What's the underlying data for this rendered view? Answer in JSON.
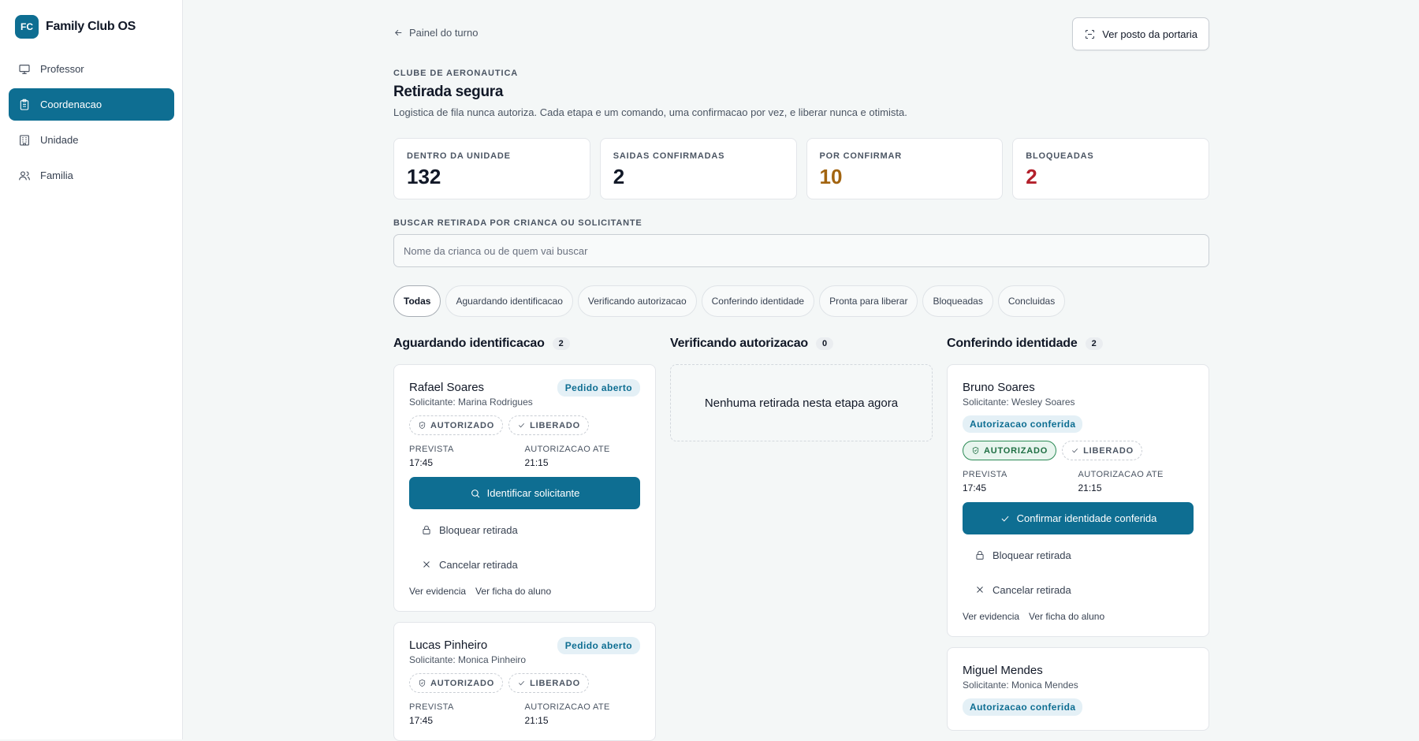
{
  "brand": {
    "logo": "FC",
    "name": "Family Club OS"
  },
  "nav": [
    {
      "label": "Professor",
      "icon": "presentation-icon",
      "active": false
    },
    {
      "label": "Coordenacao",
      "icon": "clipboard-icon",
      "active": true
    },
    {
      "label": "Unidade",
      "icon": "building-icon",
      "active": false
    },
    {
      "label": "Familia",
      "icon": "users-icon",
      "active": false
    }
  ],
  "header": {
    "back_label": "Painel do turno",
    "portaria_label": "Ver posto da portaria",
    "eyebrow": "CLUBE DE AERONAUTICA",
    "title": "Retirada segura",
    "subtitle": "Logistica de fila nunca autoriza. Cada etapa e um comando, uma confirmacao por vez, e liberar nunca e otimista."
  },
  "stats": [
    {
      "label": "DENTRO DA UNIDADE",
      "value": "132",
      "color": "#111827"
    },
    {
      "label": "SAIDAS CONFIRMADAS",
      "value": "2",
      "color": "#111827"
    },
    {
      "label": "POR CONFIRMAR",
      "value": "10",
      "color": "#a26410"
    },
    {
      "label": "BLOQUEADAS",
      "value": "2",
      "color": "#b3202b"
    }
  ],
  "search": {
    "label": "BUSCAR RETIRADA POR CRIANCA OU SOLICITANTE",
    "placeholder": "Nome da crianca ou de quem vai buscar",
    "value": ""
  },
  "filters": [
    "Todas",
    "Aguardando identificacao",
    "Verificando autorizacao",
    "Conferindo identidade",
    "Pronta para liberar",
    "Bloqueadas",
    "Concluidas"
  ],
  "columns": {
    "aguardando": {
      "title": "Aguardando identificacao",
      "count": "2",
      "cards": [
        {
          "name": "Rafael Soares",
          "requester": "Solicitante: Marina Rodrigues",
          "badge": "Pedido aberto",
          "pill_authorized": "AUTORIZADO",
          "pill_released": "LIBERADO",
          "prevista_label": "PREVISTA",
          "prevista": "17:45",
          "autorizacao_label": "AUTORIZACAO ATE",
          "autorizacao": "21:15",
          "primary_action": "Identificar solicitante",
          "block_action": "Bloquear retirada",
          "cancel_action": "Cancelar retirada",
          "link_evidence": "Ver evidencia",
          "link_record": "Ver ficha do aluno"
        },
        {
          "name": "Lucas Pinheiro",
          "requester": "Solicitante: Monica Pinheiro",
          "badge": "Pedido aberto",
          "pill_authorized": "AUTORIZADO",
          "pill_released": "LIBERADO",
          "prevista_label": "PREVISTA",
          "prevista": "17:45",
          "autorizacao_label": "AUTORIZACAO ATE",
          "autorizacao": "21:15"
        }
      ]
    },
    "verificando": {
      "title": "Verificando autorizacao",
      "count": "0",
      "empty": "Nenhuma retirada nesta etapa agora"
    },
    "conferindo": {
      "title": "Conferindo identidade",
      "count": "2",
      "cards": [
        {
          "name": "Bruno Soares",
          "requester": "Solicitante: Wesley Soares",
          "badge": "Autorizacao conferida",
          "pill_authorized": "AUTORIZADO",
          "pill_released": "LIBERADO",
          "prevista_label": "PREVISTA",
          "prevista": "17:45",
          "autorizacao_label": "AUTORIZACAO ATE",
          "autorizacao": "21:15",
          "primary_action": "Confirmar identidade conferida",
          "block_action": "Bloquear retirada",
          "cancel_action": "Cancelar retirada",
          "link_evidence": "Ver evidencia",
          "link_record": "Ver ficha do aluno"
        },
        {
          "name": "Miguel Mendes",
          "requester": "Solicitante: Monica Mendes",
          "badge": "Autorizacao conferida"
        }
      ]
    }
  },
  "colors": {
    "accent": "#0e6e92",
    "success": "#1f6f43",
    "warning": "#a26410",
    "danger": "#b3202b"
  }
}
